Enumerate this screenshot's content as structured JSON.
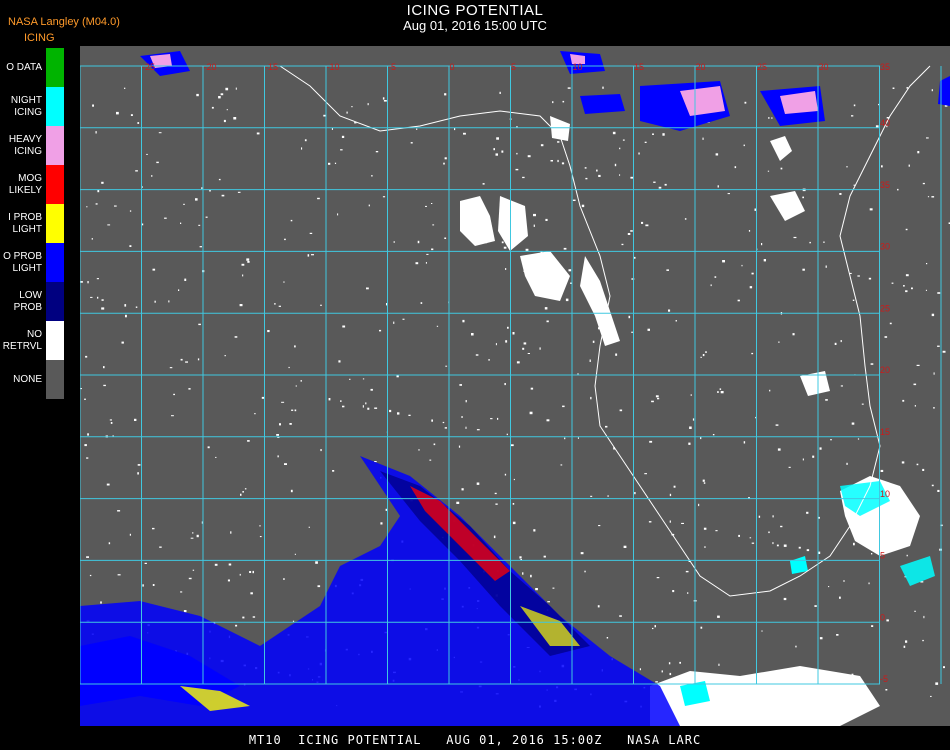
{
  "header": {
    "source": "NASA Langley (M04.0)",
    "product": "ICING",
    "title": "ICING POTENTIAL",
    "subtitle": "Aug 01, 2016 15:00 UTC"
  },
  "legend": [
    {
      "label": "O DATA",
      "color": "#00b400"
    },
    {
      "label": "NIGHT\nICING",
      "color": "#00ffff"
    },
    {
      "label": "HEAVY\nICING",
      "color": "#f0a0e6"
    },
    {
      "label": "MOG\nLIKELY",
      "color": "#ff0000"
    },
    {
      "label": "I PROB\nLIGHT",
      "color": "#ffff00"
    },
    {
      "label": "O PROB\nLIGHT",
      "color": "#0000ff"
    },
    {
      "label": "LOW\nPROB",
      "color": "#000080"
    },
    {
      "label": "NO\nRETRVL",
      "color": "#ffffff"
    },
    {
      "label": "NONE",
      "color": "#595959"
    }
  ],
  "map": {
    "grid_color": "#40c8e0",
    "coast_color": "#ffffff",
    "top_ticks": [
      "-25",
      "-20",
      "-15",
      "-10",
      "-5",
      "0",
      "5",
      "10",
      "15",
      "20",
      "25",
      "30",
      "35"
    ],
    "right_ticks": [
      "40",
      "35",
      "30",
      "25",
      "20",
      "15",
      "10",
      "5",
      "0",
      "-5"
    ]
  },
  "footer": "MT10  ICING POTENTIAL   AUG 01, 2016 15:00Z   NASA LARC"
}
